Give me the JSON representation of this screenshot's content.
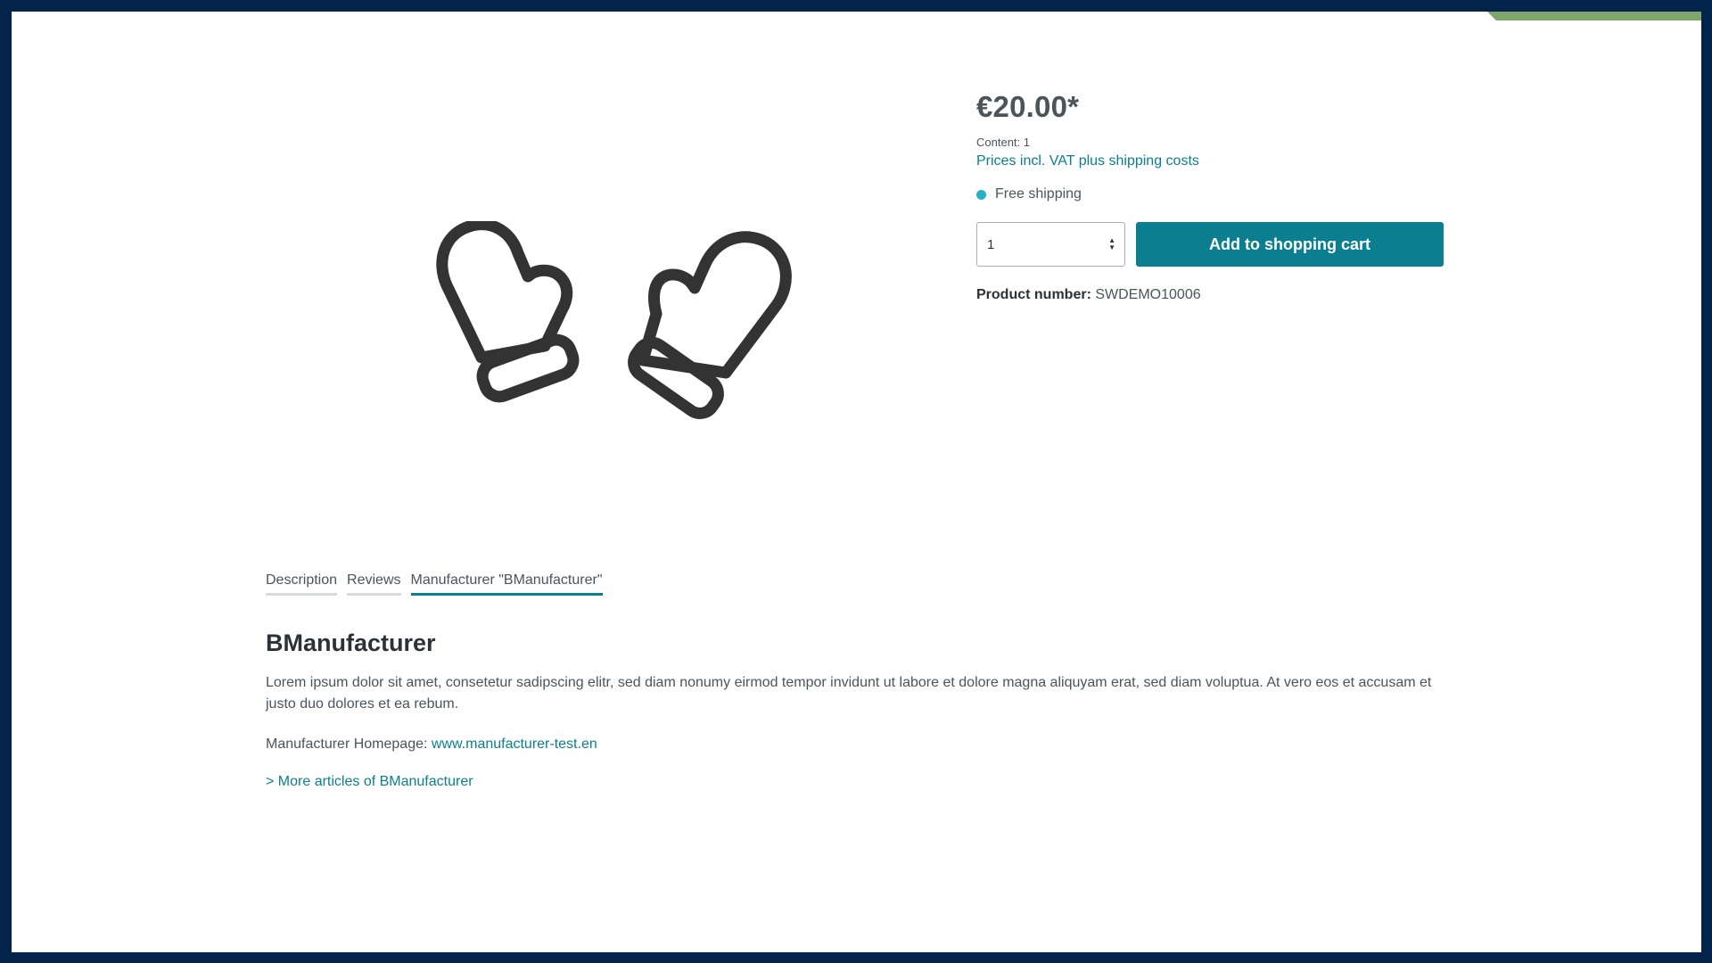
{
  "colors": {
    "background_navy": "#03244a",
    "accent_green": "#7fa56b",
    "primary_teal": "#0b7f8f",
    "delivery_dot": "#26b1c9",
    "text": "#4a545b"
  },
  "product": {
    "image_icon": "mittens-icon",
    "price": "€20.00*",
    "content": "Content: 1",
    "vat_link": "Prices incl. VAT plus shipping costs",
    "delivery": "Free shipping",
    "quantity": "1",
    "add_to_cart_label": "Add to shopping cart",
    "product_number_label": "Product number:",
    "product_number_value": "SWDEMO10006"
  },
  "tabs": [
    {
      "label": "Description",
      "active": false
    },
    {
      "label": "Reviews",
      "active": false
    },
    {
      "label": "Manufacturer \"BManufacturer\"",
      "active": true
    }
  ],
  "manufacturer": {
    "title": "BManufacturer",
    "description": "Lorem ipsum dolor sit amet, consetetur sadipscing elitr, sed diam nonumy eirmod tempor invidunt ut labore et dolore magna aliquyam erat, sed diam voluptua. At vero eos et accusam et justo duo dolores et ea rebum.",
    "homepage_label": "Manufacturer Homepage:",
    "homepage_url": "www.manufacturer-test.en",
    "more_link": "> More articles of BManufacturer"
  }
}
